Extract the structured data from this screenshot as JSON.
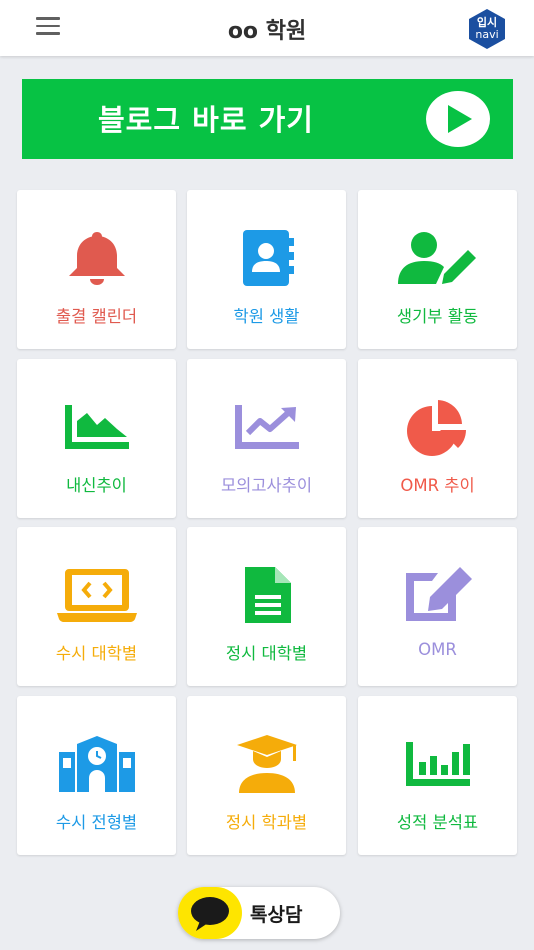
{
  "header": {
    "title": "oo 학원",
    "logo_top": "입시",
    "logo_bottom": "navi"
  },
  "banner": {
    "label": "블로그 바로 가기"
  },
  "tiles": [
    {
      "label": "출결 캘린더",
      "icon": "bell-icon",
      "color": "#e05a4f"
    },
    {
      "label": "학원 생활",
      "icon": "contact-book-icon",
      "color": "#1d9ae6"
    },
    {
      "label": "생기부 활동",
      "icon": "user-edit-icon",
      "color": "#10b93f"
    },
    {
      "label": "내신추이",
      "icon": "area-chart-icon",
      "color": "#10b93f"
    },
    {
      "label": "모의고사추이",
      "icon": "line-chart-icon",
      "color": "#9b8fdc"
    },
    {
      "label": "OMR 추이",
      "icon": "pie-chart-icon",
      "color": "#f05a4a"
    },
    {
      "label": "수시 대학별",
      "icon": "laptop-code-icon",
      "color": "#f5ac0a"
    },
    {
      "label": "정시 대학별",
      "icon": "document-icon",
      "color": "#10b93f"
    },
    {
      "label": "OMR",
      "icon": "edit-icon",
      "color": "#9b8fdc"
    },
    {
      "label": "수시 전형별",
      "icon": "school-icon",
      "color": "#1d9ae6"
    },
    {
      "label": "정시 학과별",
      "icon": "graduate-icon",
      "color": "#f5ac0a"
    },
    {
      "label": "성적 분석표",
      "icon": "bar-chart-icon",
      "color": "#10b93f"
    }
  ],
  "kakao": {
    "label": "톡상담"
  }
}
